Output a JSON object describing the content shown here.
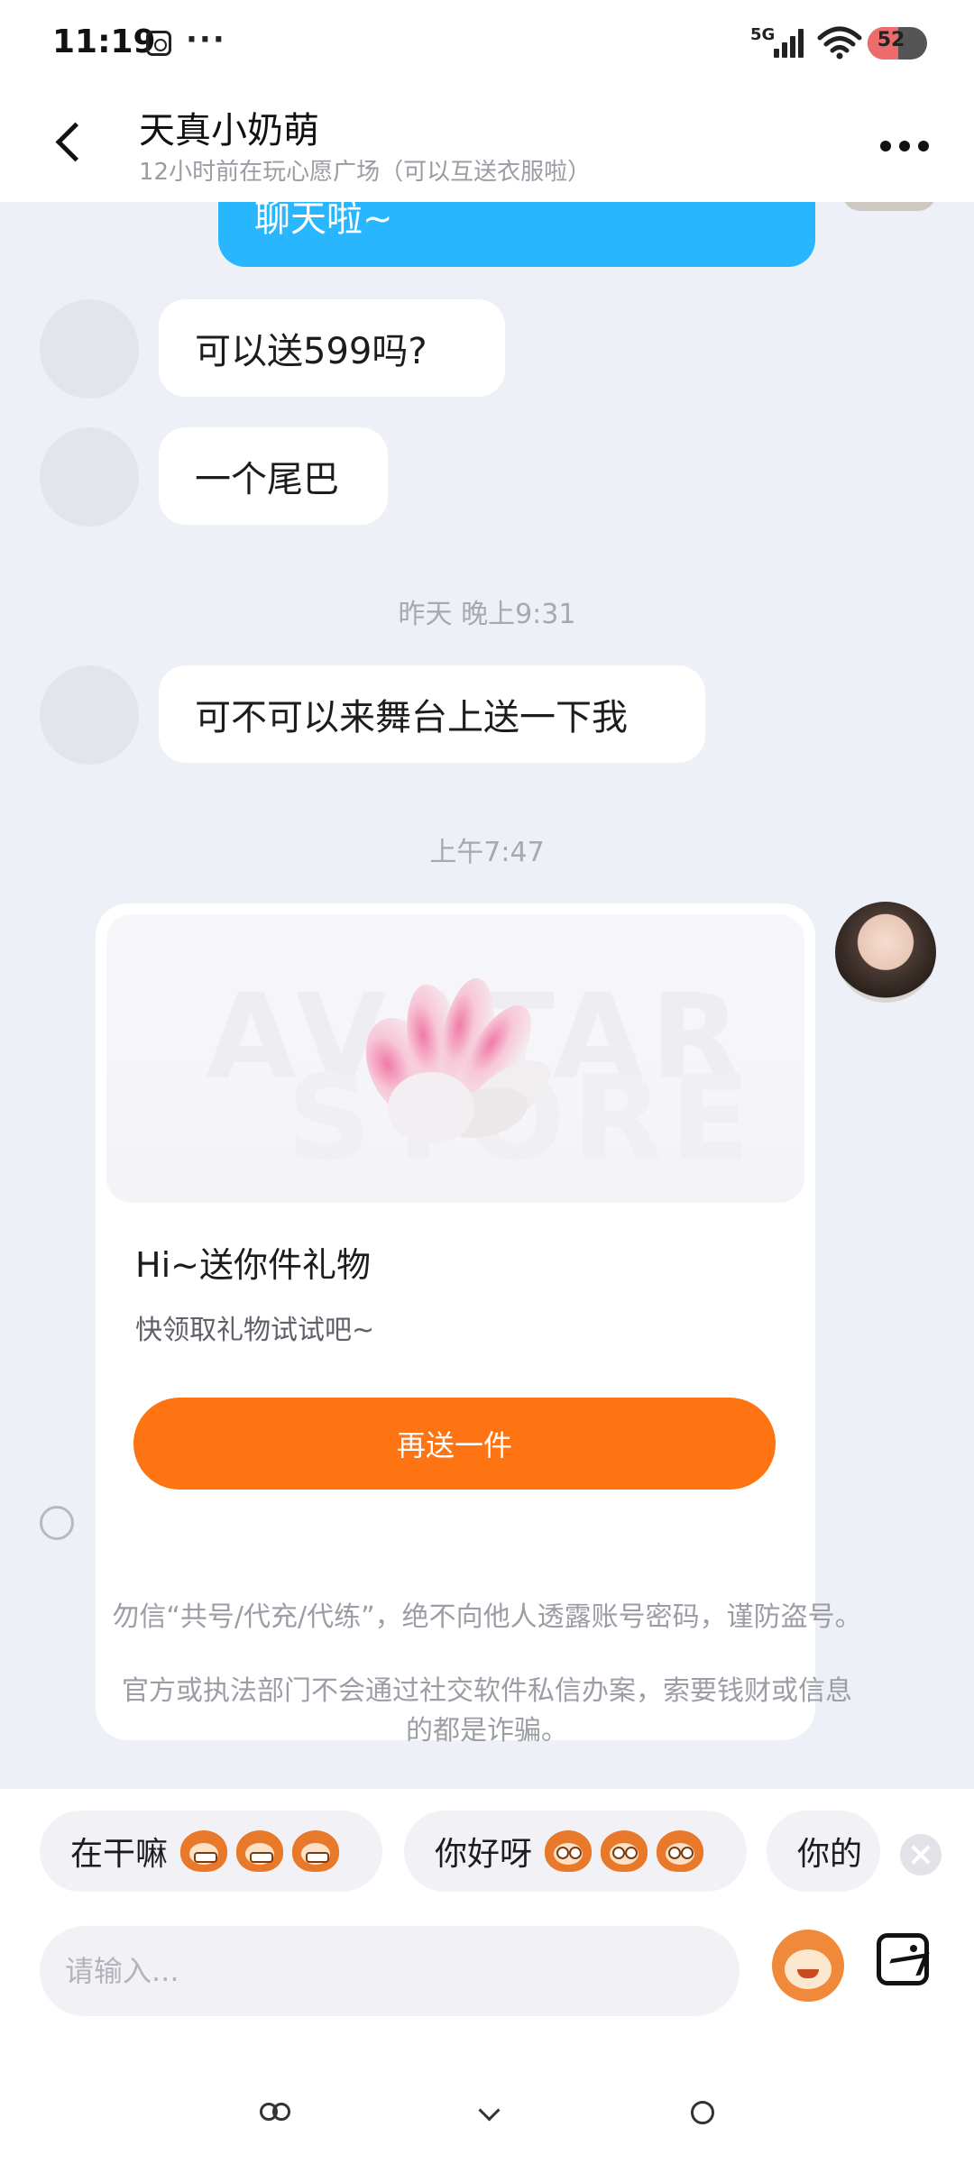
{
  "status_bar": {
    "time": "11:19",
    "dots": "···",
    "network": "5G",
    "battery": "52",
    "battery_level": 0.52
  },
  "header": {
    "title": "天真小奶萌",
    "subtitle": "12小时前在玩心愿广场（可以互送衣服啦）"
  },
  "messages": {
    "self_top_text": "聊天啦~",
    "msg1": "可以送599吗?",
    "msg2": "一个尾巴",
    "timestamp1": "昨天 晚上9:31",
    "msg3": "可不可以来舞台上送一下我",
    "timestamp2": "上午7:47"
  },
  "gift_card": {
    "watermark_line1": "AVATAR",
    "watermark_line2": "STORE",
    "title": "Hi~送你件礼物",
    "description": "快领取礼物试试吧~",
    "button_label": "再送一件"
  },
  "notices": {
    "line1": "勿信“共号/代充/代练”，绝不向他人透露账号密码，谨防盗号。",
    "line2a": "官方或执法部门不会通过社交软件私信办案，索要钱财或信息",
    "line2b": "的都是诈骗。"
  },
  "quick_replies": [
    {
      "label": "在干嘛"
    },
    {
      "label": "你好呀"
    },
    {
      "label": "你的"
    }
  ],
  "input": {
    "placeholder": "请输入..."
  },
  "colors": {
    "accent_orange": "#ff7412",
    "self_bubble_blue": "#28b6ff",
    "background": "#eef0f7"
  },
  "icons": [
    "back-arrow-icon",
    "more-dots-icon",
    "close-icon",
    "emoji-icon",
    "image-icon",
    "infinity-icon",
    "heart-icon",
    "face-icon"
  ]
}
